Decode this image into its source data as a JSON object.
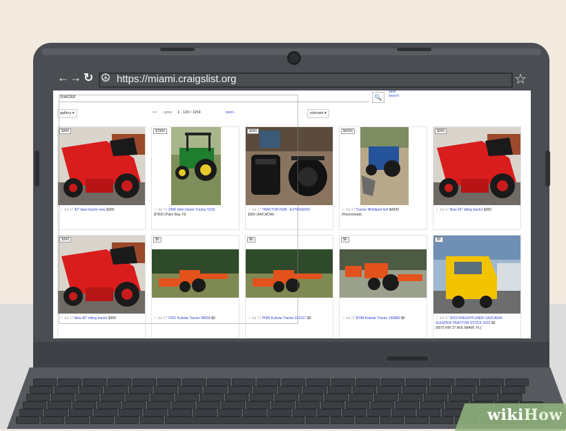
{
  "browser": {
    "back_icon": "←",
    "forward_icon": "→",
    "reload_icon": "↻",
    "site_icon": "☮",
    "url": "https://miami.craigslist.org",
    "bookmark_icon": "☆"
  },
  "search": {
    "query": "tractor",
    "button_icon": "🔍",
    "save_label": "save search"
  },
  "toolbar": {
    "view_label": "gallery ▾",
    "pager_prev": "<<",
    "pager_prev_page": "‹ prev",
    "pager_range": "1 - 120 / 1159",
    "pager_next": "next ›",
    "sort_label": "relevant ▾"
  },
  "listings": [
    {
      "price": "$300",
      "title": "42\" lawn tractor new",
      "price2": "$300",
      "location": ""
    },
    {
      "price": "$7900",
      "title": "1998 John Deere Tractor 5310",
      "price2": "",
      "location": "$7900 (Palm Bay, Fl)"
    },
    {
      "price": "$300",
      "title": "TRACTOR HUB - EXTENSION",
      "price2": "",
      "location": "$300 (ARCADIA)"
    },
    {
      "price": "$4200",
      "title": "Tractor NHolland 4x4",
      "price2": "$4200",
      "location": "(Homestead)"
    },
    {
      "price": "$300",
      "title": "New 42\" riding tractor",
      "price2": "$300",
      "location": ""
    },
    {
      "price": "$300",
      "title": "New 42\" riding tractor",
      "price2": "$300",
      "location": ""
    },
    {
      "price": "$0",
      "title": "V921 Kubota Tractor 05004",
      "price2": "$0",
      "location": ""
    },
    {
      "price": "$0",
      "title": "P690 Kubota Tractor 312167",
      "price2": "$0",
      "location": ""
    },
    {
      "price": "$0",
      "title": "B748 Kubota Tractor 159880",
      "price2": "$0",
      "location": ""
    },
    {
      "price": "$0",
      "title": "2023 FREIGHTLINER CASCADIA SLEEPER TRACTOR STOCK 1815",
      "price2": "$0",
      "location": "(6975 NW 37 AVE MIAMI, FL)"
    }
  ],
  "listing_fav_icon": "☆ Jul 17",
  "watermark": {
    "wiki": "wiki",
    "how": "How"
  }
}
